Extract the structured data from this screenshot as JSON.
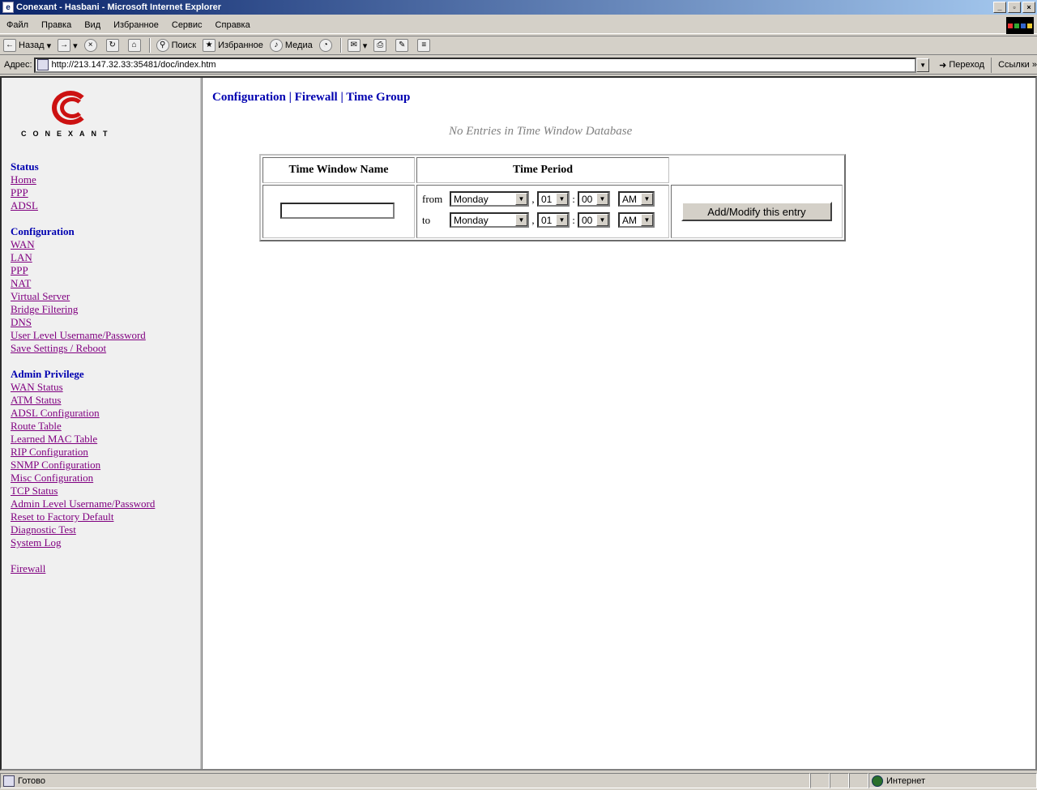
{
  "window": {
    "title": "Conexant - Hasbani - Microsoft Internet Explorer"
  },
  "menu": [
    "Файл",
    "Правка",
    "Вид",
    "Избранное",
    "Сервис",
    "Справка"
  ],
  "toolbar": {
    "back": "Назад",
    "search": "Поиск",
    "favorites": "Избранное",
    "media": "Медиа"
  },
  "address": {
    "label": "Адрес:",
    "url": "http://213.147.32.33:35481/doc/index.htm",
    "go": "Переход",
    "links": "Ссылки"
  },
  "sidebar": {
    "logo_text": "CONEXANT",
    "sections": [
      {
        "title": "Status",
        "links": [
          "Home",
          "PPP",
          "ADSL"
        ]
      },
      {
        "title": "Configuration",
        "links": [
          "WAN",
          "LAN",
          "PPP",
          "NAT",
          "Virtual Server",
          "Bridge Filtering",
          "DNS",
          "User Level Username/Password",
          "Save Settings / Reboot"
        ]
      },
      {
        "title": "Admin Privilege",
        "links": [
          "WAN Status",
          "ATM Status",
          "ADSL Configuration",
          "Route Table",
          "Learned MAC Table",
          "RIP Configuration",
          "SNMP Configuration",
          "Misc Configuration",
          "TCP Status",
          "Admin Level Username/Password",
          "Reset to Factory Default",
          "Diagnostic Test",
          "System Log"
        ]
      },
      {
        "title": "",
        "links": [
          "Firewall"
        ]
      }
    ]
  },
  "main": {
    "breadcrumb": [
      "Configuration",
      "Firewall",
      "Time Group"
    ],
    "separator": "|",
    "empty_message": "No Entries in Time Window Database",
    "table": {
      "col_name": "Time Window Name",
      "col_period": "Time Period",
      "name_value": "",
      "from_label": "from",
      "to_label": "to",
      "from": {
        "day": "Monday",
        "hour": "01",
        "minute": "00",
        "ampm": "AM"
      },
      "to": {
        "day": "Monday",
        "hour": "01",
        "minute": "00",
        "ampm": "AM"
      },
      "comma": ",",
      "colon": ":",
      "submit": "Add/Modify this entry"
    }
  },
  "statusbar": {
    "text": "Готово",
    "zone": "Интернет"
  }
}
